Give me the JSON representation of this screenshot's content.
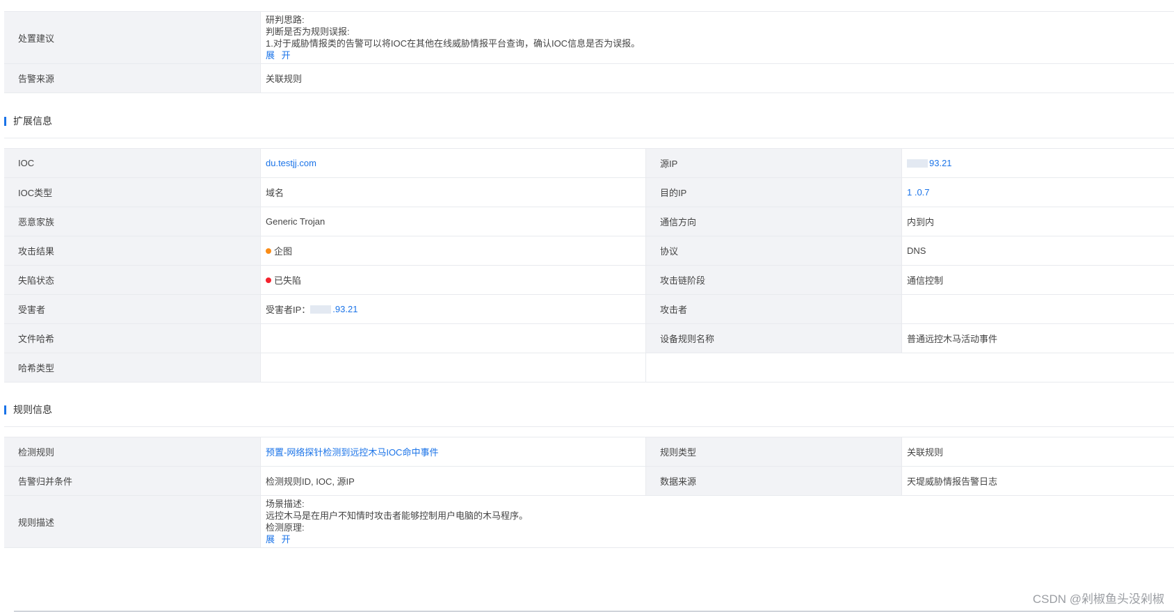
{
  "summary": {
    "advice_label": "处置建议",
    "advice_lines": [
      "研判思路:",
      "判断是否为规则误报:",
      "1.对于威胁情报类的告警可以将IOC在其他在线威胁情报平台查询，确认IOC信息是否为误报。"
    ],
    "expand": "展 开",
    "source_label": "告警来源",
    "source_value": "关联规则"
  },
  "ext": {
    "title": "扩展信息",
    "rows": [
      {
        "l1": "IOC",
        "v1": "du.testjj.com",
        "l2": "源IP",
        "v2": "93.21"
      },
      {
        "l1": "IOC类型",
        "v1": "域名",
        "l2": "目的IP",
        "v2": "1 .0.7"
      },
      {
        "l1": "恶意家族",
        "v1": "Generic Trojan",
        "l2": "通信方向",
        "v2": "内到内"
      },
      {
        "l1": "攻击结果",
        "v1": "企图",
        "l2": "协议",
        "v2": "DNS"
      },
      {
        "l1": "失陷状态",
        "v1": "已失陷",
        "l2": "攻击链阶段",
        "v2": "通信控制"
      },
      {
        "l1": "受害者",
        "v1_prefix": "受害者IP：",
        "v1": ".93.21",
        "l2": "攻击者",
        "v2": ""
      },
      {
        "l1": "文件哈希",
        "v1": "",
        "l2": "设备规则名称",
        "v2": "普通远控木马活动事件"
      },
      {
        "l1": "哈希类型",
        "v1": "",
        "l2": "",
        "v2": ""
      }
    ],
    "colors": {
      "attempt": "#fa8c16",
      "compromised": "#f5222d"
    }
  },
  "rule": {
    "title": "规则信息",
    "rows": [
      {
        "l1": "检测规则",
        "v1": "预置-网络探针检测到远控木马IOC命中事件",
        "l2": "规则类型",
        "v2": "关联规则"
      },
      {
        "l1": "告警归并条件",
        "v1": "检测规则ID, IOC, 源IP",
        "l2": "数据来源",
        "v2": "天堤威胁情报告警日志"
      }
    ],
    "desc_label": "规则描述",
    "desc_lines": [
      "场景描述:",
      "远控木马是在用户不知情时攻击者能够控制用户电脑的木马程序。",
      "检测原理:"
    ],
    "expand": "展 开"
  },
  "watermark": "CSDN @剁椒鱼头没剁椒"
}
